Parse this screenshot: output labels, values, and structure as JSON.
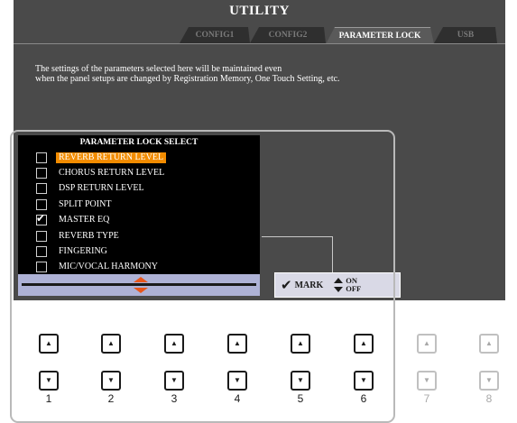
{
  "screen": {
    "title": "UTILITY",
    "tabs": [
      {
        "label": "CONFIG1",
        "active": false
      },
      {
        "label": "CONFIG2",
        "active": false
      },
      {
        "label": "PARAMETER LOCK",
        "active": true
      },
      {
        "label": "USB",
        "active": false
      }
    ],
    "description_line1": "The settings of the parameters selected here will be maintained even",
    "description_line2": "when the panel setups are changed by Registration Memory, One Touch Setting, etc."
  },
  "lock_panel": {
    "title": "PARAMETER LOCK SELECT",
    "items": [
      {
        "label": "REVERB RETURN LEVEL",
        "checked": false,
        "selected": true
      },
      {
        "label": "CHORUS RETURN LEVEL",
        "checked": false,
        "selected": false
      },
      {
        "label": "DSP RETURN LEVEL",
        "checked": false,
        "selected": false
      },
      {
        "label": "SPLIT POINT",
        "checked": false,
        "selected": false
      },
      {
        "label": "MASTER EQ",
        "checked": true,
        "selected": false
      },
      {
        "label": "REVERB TYPE",
        "checked": false,
        "selected": false
      },
      {
        "label": "FINGERING",
        "checked": false,
        "selected": false
      },
      {
        "label": "MIC/VOCAL HARMONY",
        "checked": false,
        "selected": false
      }
    ]
  },
  "mark_box": {
    "mark_label": "MARK",
    "on_label": "ON",
    "off_label": "OFF"
  },
  "buttons": [
    {
      "number": "1",
      "enabled": true
    },
    {
      "number": "2",
      "enabled": true
    },
    {
      "number": "3",
      "enabled": true
    },
    {
      "number": "4",
      "enabled": true
    },
    {
      "number": "5",
      "enabled": true
    },
    {
      "number": "6",
      "enabled": true
    },
    {
      "number": "7",
      "enabled": false
    },
    {
      "number": "8",
      "enabled": false
    }
  ],
  "colors": {
    "screen_bg": "#4a4a4a",
    "selection": "#f28c00",
    "scrollbar": "#aeb2d6",
    "arrow": "#e8561b"
  }
}
